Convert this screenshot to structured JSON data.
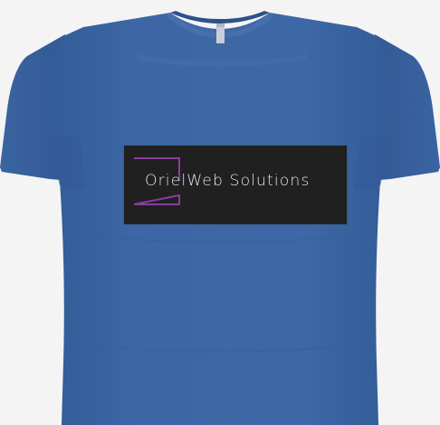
{
  "shirt": {
    "body_color": "#3d67a4",
    "shadow_color": "#2f5690",
    "highlight_color": "#4a76b3",
    "tag_color": "#c9cfd8"
  },
  "logo": {
    "text": "OrielWeb Solutions",
    "panel_color": "#202021",
    "text_color": "#e3e3e6",
    "frame_color": "#8a3c9e"
  }
}
